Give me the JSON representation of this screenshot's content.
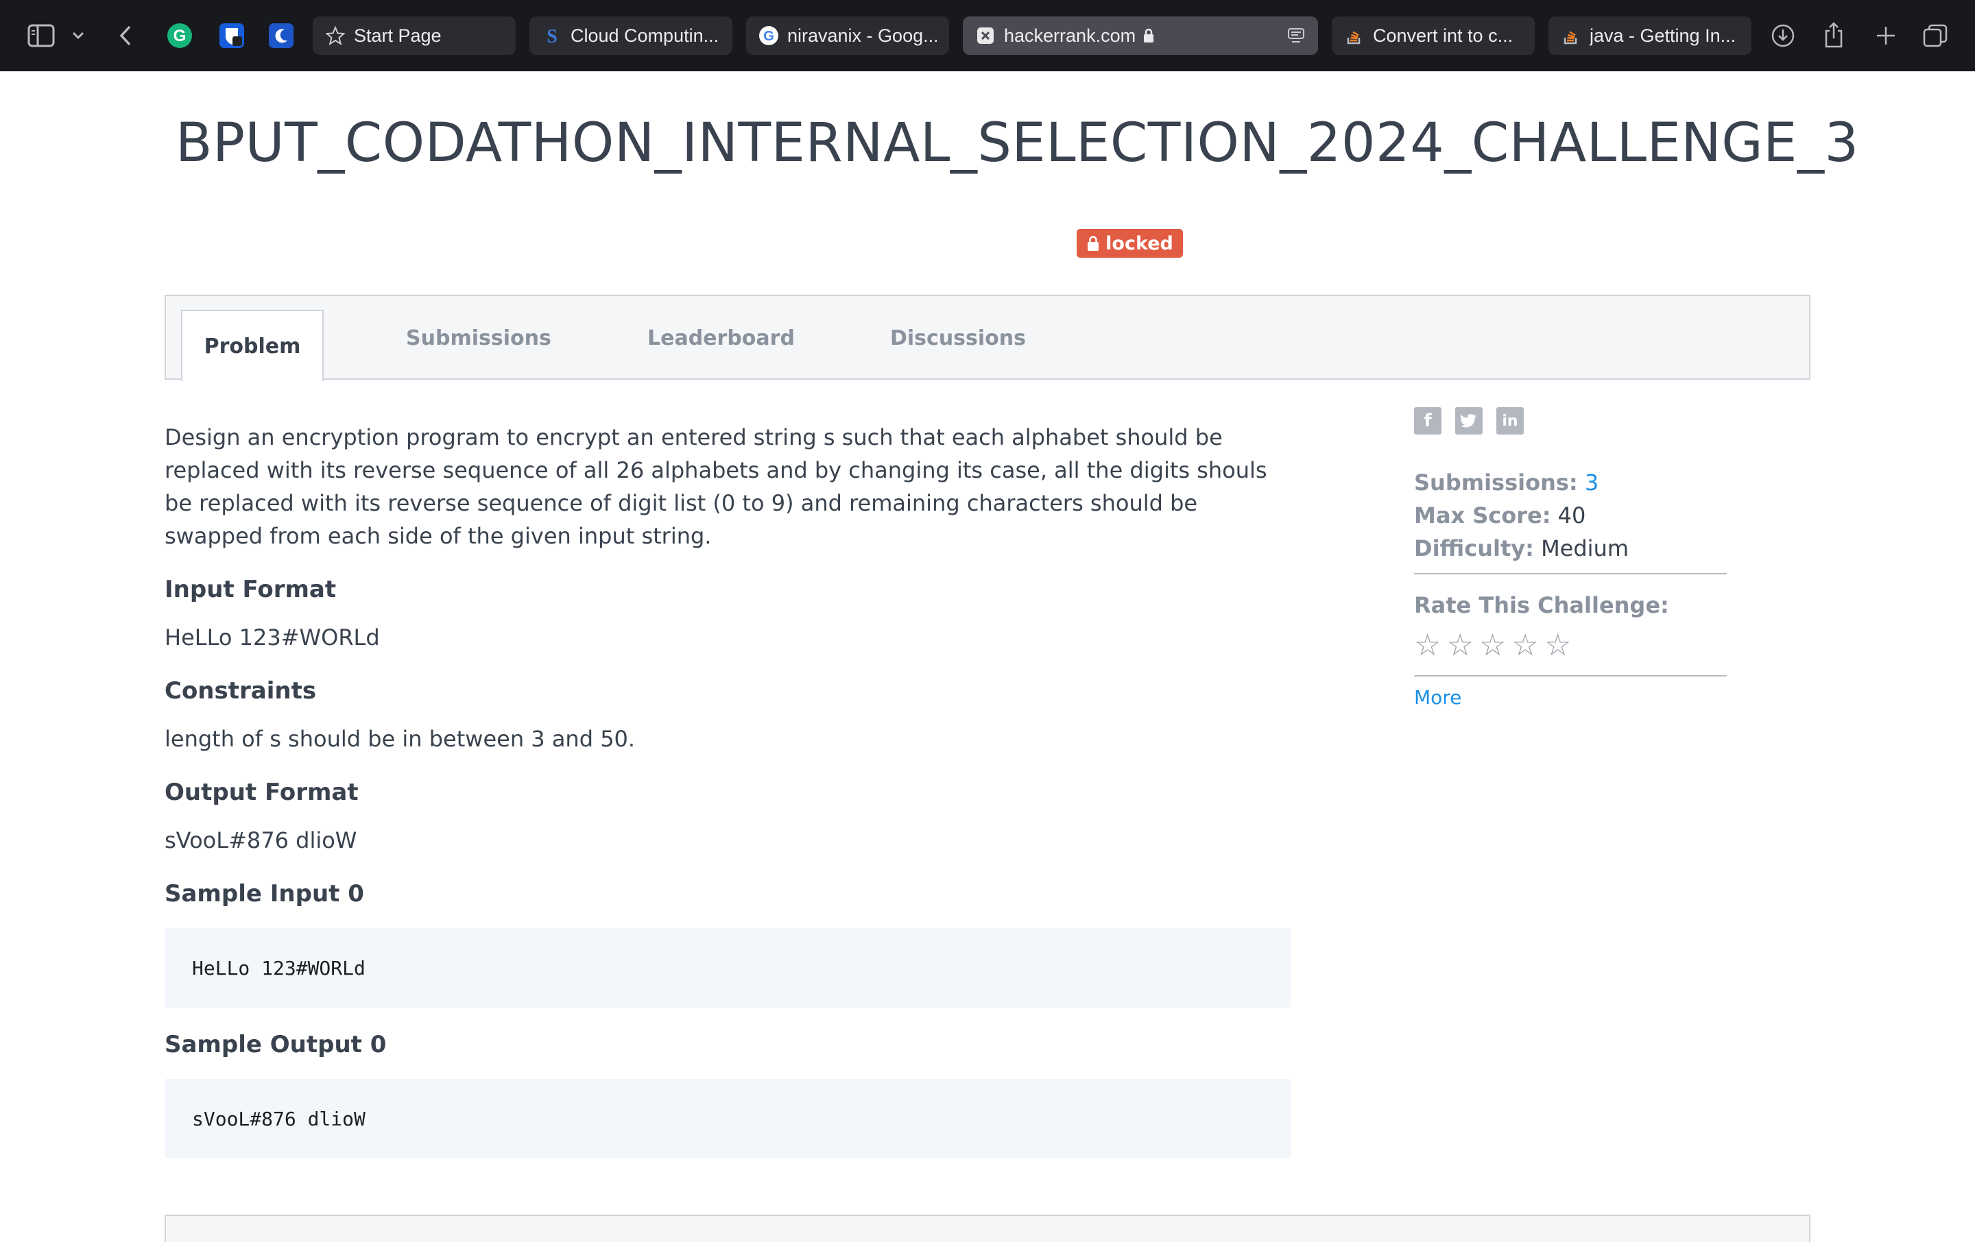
{
  "browser": {
    "tabs": [
      {
        "label": "Start Page",
        "icon": "star-icon"
      },
      {
        "label": "Cloud Computin...",
        "icon": "s-logo-icon"
      },
      {
        "label": "niravanix - Goog...",
        "icon": "google-icon"
      },
      {
        "label": "hackerrank.com",
        "icon": "hackerrank-icon",
        "active": true
      },
      {
        "label": "Convert int to c...",
        "icon": "stackoverflow-icon"
      },
      {
        "label": "java - Getting In...",
        "icon": "stackoverflow-icon"
      }
    ]
  },
  "challenge": {
    "title": "BPUT_CODATHON_INTERNAL_SELECTION_2024_CHALLENGE_3",
    "status": "locked"
  },
  "tabs": [
    "Problem",
    "Submissions",
    "Leaderboard",
    "Discussions"
  ],
  "problem": {
    "description": "Design an encryption program to encrypt an entered string s such that each alphabet should be replaced with its reverse sequence of all 26 alphabets and by changing its case, all the digits shouls be replaced with its reverse sequence of digit list (0 to 9) and remaining characters should be swapped from each side of the given input string.",
    "input_format_heading": "Input Format",
    "input_format": "HeLLo 123#WORLd",
    "constraints_heading": "Constraints",
    "constraints": "length of s should be in between 3 and 50.",
    "output_format_heading": "Output Format",
    "output_format": "sVooL#876 dlioW",
    "sample_input_heading": "Sample Input 0",
    "sample_input": "HeLLo 123#WORLd",
    "sample_output_heading": "Sample Output 0",
    "sample_output": "sVooL#876 dlioW"
  },
  "sidebar": {
    "submissions_label": "Submissions:",
    "submissions_value": "3",
    "max_score_label": "Max Score:",
    "max_score_value": "40",
    "difficulty_label": "Difficulty:",
    "difficulty_value": "Medium",
    "rate_label": "Rate This Challenge:",
    "rating": 0,
    "more_label": "More"
  }
}
